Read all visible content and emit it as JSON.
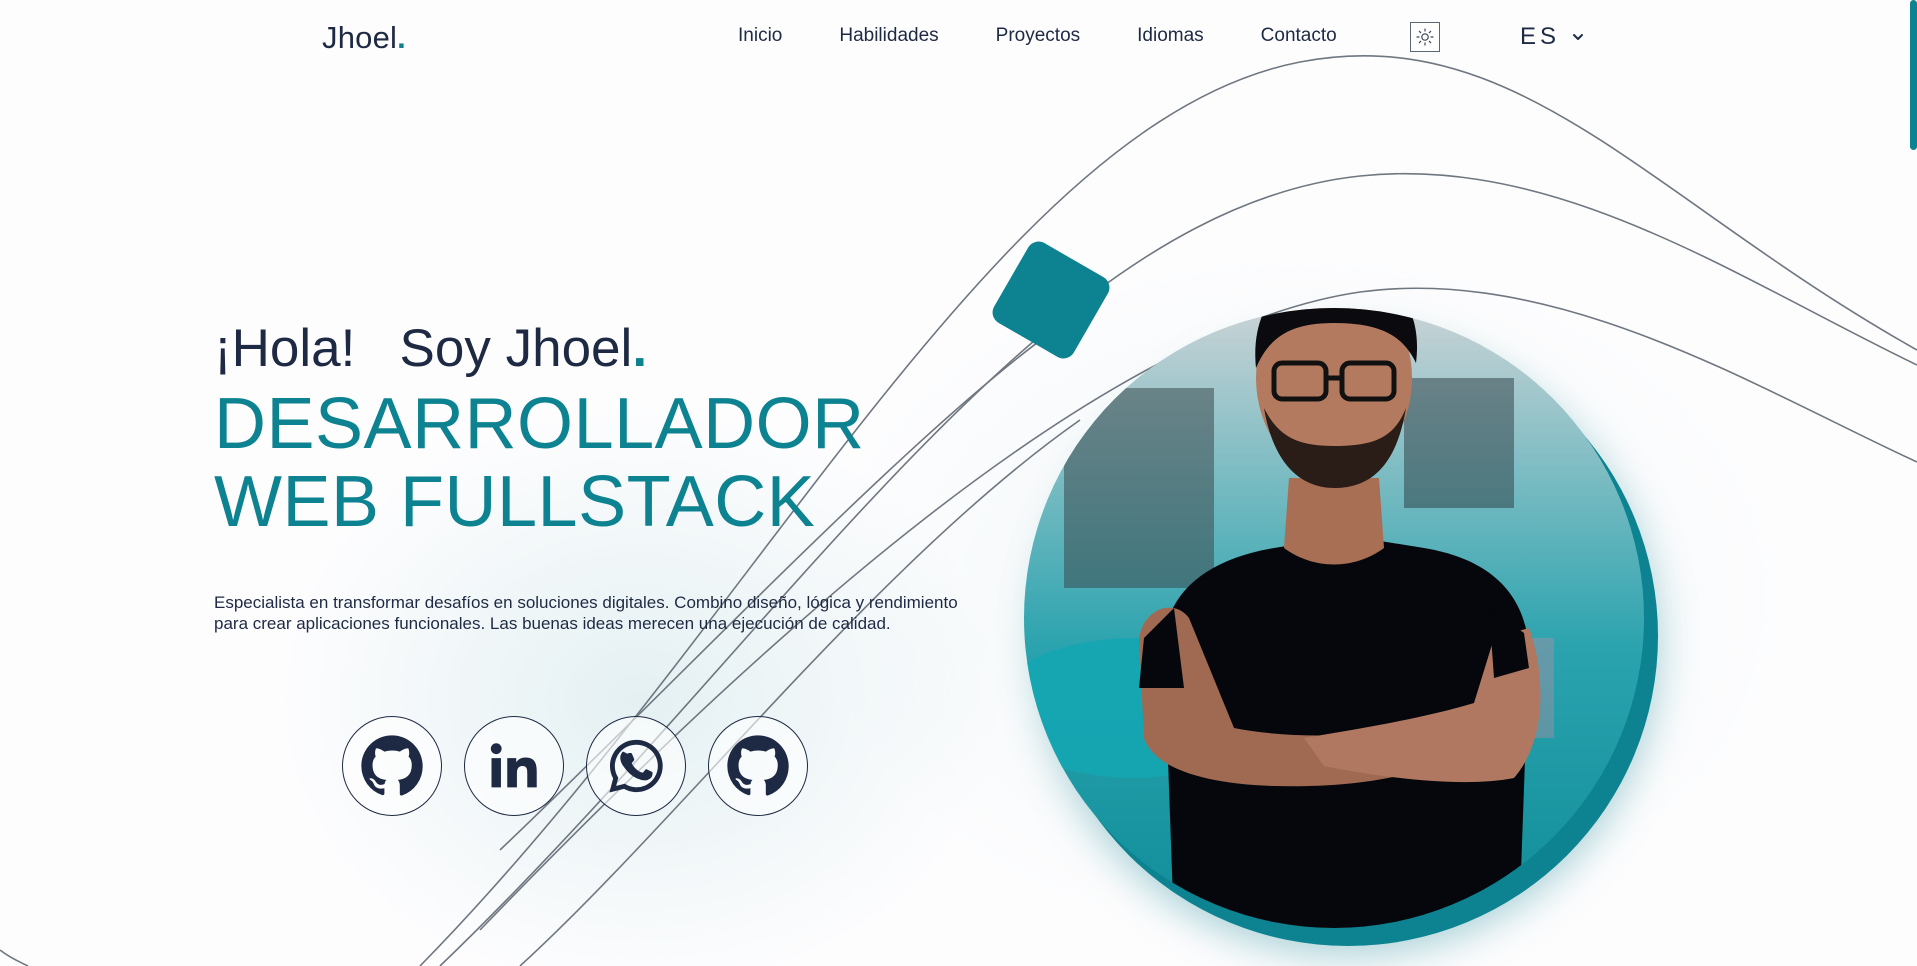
{
  "header": {
    "logo_text": "Jhoel",
    "logo_dot": ".",
    "nav": [
      {
        "label": "Inicio"
      },
      {
        "label": "Habilidades"
      },
      {
        "label": "Proyectos"
      },
      {
        "label": "Idiomas"
      },
      {
        "label": "Contacto"
      }
    ],
    "theme_toggle_icon": "sun-icon",
    "language": {
      "value": "ES",
      "icon": "chevron-down-icon"
    }
  },
  "hero": {
    "greeting": "¡Hola!   Soy Jhoel",
    "greeting_dot": ".",
    "role_line_1": "DESARROLLADOR",
    "role_line_2": "WEB FULLSTACK",
    "description": "Especialista en transformar desafíos en soluciones digitales. Combino diseño, lógica y rendimiento para crear aplicaciones funcionales. Las buenas ideas merecen una ejecución de calidad.",
    "socials": [
      {
        "icon": "github-icon"
      },
      {
        "icon": "linkedin-icon"
      },
      {
        "icon": "whatsapp-icon"
      },
      {
        "icon": "github-icon"
      }
    ]
  },
  "colors": {
    "accent": "#0d8290",
    "text": "#1e2a44",
    "background": "#fdfdfe"
  }
}
